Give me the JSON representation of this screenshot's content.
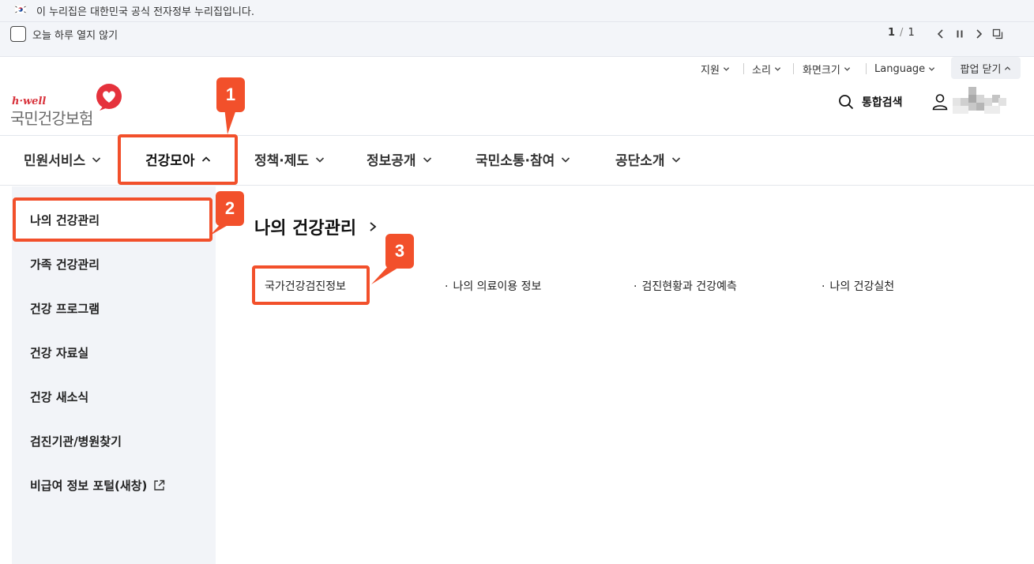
{
  "gov_banner": {
    "text": "이 누리집은 대한민국 공식 전자정부 누리집입니다."
  },
  "popup": {
    "checkbox_label": "오늘 하루 열지 않기",
    "page_current": "1",
    "page_separator": "/",
    "page_total": "1"
  },
  "utility_nav": {
    "support": "지원",
    "sound": "소리",
    "screen_size": "화면크기",
    "language": "Language",
    "popup_close": "팝업 닫기"
  },
  "logo": {
    "tagline": "h·well",
    "name": "국민건강보험"
  },
  "header": {
    "search_label": "통합검색"
  },
  "gnb": {
    "items": [
      "민원서비스",
      "건강모아",
      "정책·제도",
      "정보공개",
      "국민소통·참여",
      "공단소개"
    ],
    "active_index": 1
  },
  "sidebar": {
    "items": [
      "나의 건강관리",
      "가족 건강관리",
      "건강 프로그램",
      "건강 자료실",
      "건강 새소식",
      "검진기관/병원찾기",
      "비급여 정보 포털(새창)"
    ],
    "active_index": 0
  },
  "content": {
    "title": "나의 건강관리",
    "sub_items": [
      "국가건강검진정보",
      "나의 의료이용 정보",
      "검진현황과 건강예측",
      "나의 건강실천"
    ],
    "bullet": "·"
  },
  "badges": [
    "1",
    "2",
    "3"
  ],
  "colors": {
    "accent": "#f2502b",
    "brand_red": "#d8323b",
    "sidebar_bg": "#f2f4f8",
    "banner_bg": "#f3f5f9"
  }
}
